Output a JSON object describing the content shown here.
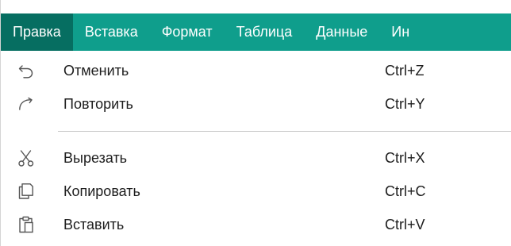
{
  "menubar": {
    "items": [
      {
        "label": "Правка"
      },
      {
        "label": "Вставка"
      },
      {
        "label": "Формат"
      },
      {
        "label": "Таблица"
      },
      {
        "label": "Данные"
      },
      {
        "label": "Ин"
      }
    ],
    "active_index": 0
  },
  "dropdown": {
    "items": [
      {
        "icon": "undo-icon",
        "label": "Отменить",
        "shortcut": "Ctrl+Z"
      },
      {
        "icon": "redo-icon",
        "label": "Повторить",
        "shortcut": "Ctrl+Y"
      },
      {
        "icon": "cut-icon",
        "label": "Вырезать",
        "shortcut": "Ctrl+X"
      },
      {
        "icon": "copy-icon",
        "label": "Копировать",
        "shortcut": "Ctrl+C"
      },
      {
        "icon": "paste-icon",
        "label": "Вставить",
        "shortcut": "Ctrl+V"
      }
    ]
  },
  "colors": {
    "menubar": "#0f9e8c",
    "menubar_active": "#066e61",
    "menu_text": "#1d1d1d",
    "icon": "#555555"
  }
}
